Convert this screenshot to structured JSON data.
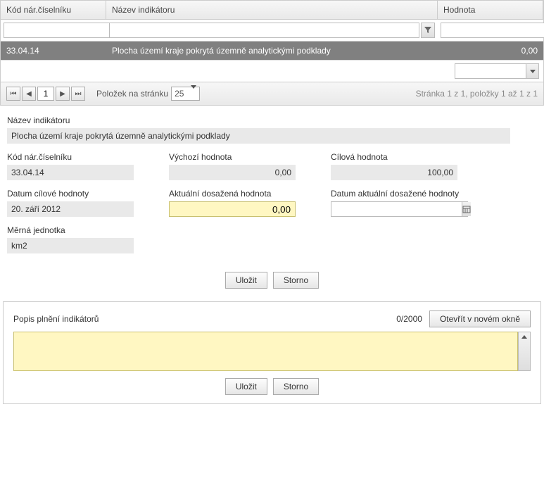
{
  "grid": {
    "headers": {
      "code": "Kód nár.číselníku",
      "name": "Název indikátoru",
      "value": "Hodnota"
    },
    "row": {
      "code": "33.04.14",
      "name": "Plocha území kraje pokrytá územně analytickými podklady",
      "value": "0,00"
    },
    "pager": {
      "page": "1",
      "per_page_label": "Položek na stránku",
      "per_page_value": "25",
      "summary": "Stránka 1 z 1, položky 1 až 1 z 1"
    }
  },
  "form": {
    "name_label": "Název indikátoru",
    "name_value": "Plocha území kraje pokrytá územně analytickými podklady",
    "code_label": "Kód nár.číselníku",
    "code_value": "33.04.14",
    "initial_label": "Výchozí hodnota",
    "initial_value": "0,00",
    "target_label": "Cílová hodnota",
    "target_value": "100,00",
    "target_date_label": "Datum cílové hodnoty",
    "target_date_value": "20. září 2012",
    "current_label": "Aktuální dosažená hodnota",
    "current_value": "0,00",
    "current_date_label": "Datum aktuální dosažené hodnoty",
    "current_date_value": "",
    "unit_label": "Měrná jednotka",
    "unit_value": "km2"
  },
  "buttons": {
    "save": "Uložit",
    "cancel": "Storno",
    "open_new": "Otevřít v novém okně"
  },
  "desc": {
    "title": "Popis plnění indikátorů",
    "counter": "0/2000",
    "value": ""
  }
}
